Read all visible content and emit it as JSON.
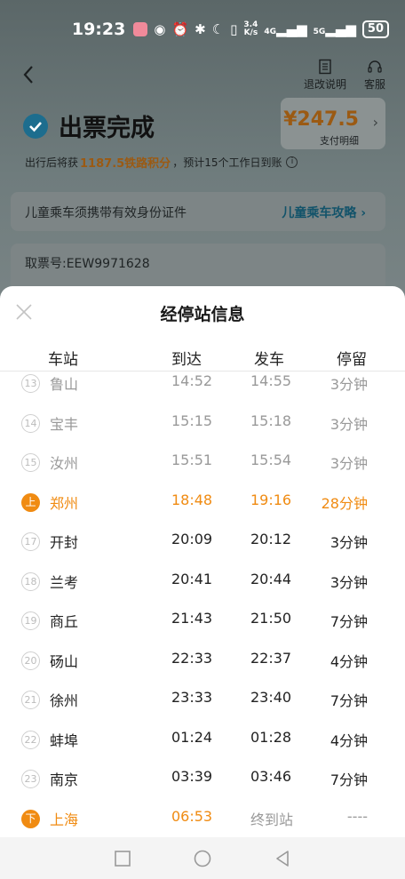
{
  "status_bar": {
    "time": "19:23",
    "speed_top": "3.4",
    "speed_bottom": "K/s",
    "net1": "4G",
    "net2": "5G",
    "battery": "50"
  },
  "header": {
    "refund_label": "退改说明",
    "service_label": "客服"
  },
  "ticket": {
    "title": "出票完成",
    "price": "¥247.5",
    "price_detail": "支付明细",
    "points_prefix": "出行后将获",
    "points_value": "1187.5铁路积分",
    "points_suffix": "，预计15个工作日到账"
  },
  "child_notice": {
    "text": "儿童乘车须携带有效身份证件",
    "link": "儿童乘车攻略 ›"
  },
  "ticket_no": "取票号:EEW9971628",
  "sheet": {
    "title": "经停站信息",
    "columns": {
      "station": "车站",
      "arrive": "到达",
      "depart": "发车",
      "stay": "停留"
    },
    "rows": [
      {
        "idx": "13",
        "station": "鲁山",
        "arrive": "14:52",
        "depart": "14:55",
        "stay": "3分钟",
        "state": "passed"
      },
      {
        "idx": "14",
        "station": "宝丰",
        "arrive": "15:15",
        "depart": "15:18",
        "stay": "3分钟",
        "state": "passed"
      },
      {
        "idx": "15",
        "station": "汝州",
        "arrive": "15:51",
        "depart": "15:54",
        "stay": "3分钟",
        "state": "passed"
      },
      {
        "idx": "上",
        "station": "郑州",
        "arrive": "18:48",
        "depart": "19:16",
        "stay": "28分钟",
        "state": "board"
      },
      {
        "idx": "17",
        "station": "开封",
        "arrive": "20:09",
        "depart": "20:12",
        "stay": "3分钟",
        "state": "normal"
      },
      {
        "idx": "18",
        "station": "兰考",
        "arrive": "20:41",
        "depart": "20:44",
        "stay": "3分钟",
        "state": "normal"
      },
      {
        "idx": "19",
        "station": "商丘",
        "arrive": "21:43",
        "depart": "21:50",
        "stay": "7分钟",
        "state": "normal"
      },
      {
        "idx": "20",
        "station": "砀山",
        "arrive": "22:33",
        "depart": "22:37",
        "stay": "4分钟",
        "state": "normal"
      },
      {
        "idx": "21",
        "station": "徐州",
        "arrive": "23:33",
        "depart": "23:40",
        "stay": "7分钟",
        "state": "normal"
      },
      {
        "idx": "22",
        "station": "蚌埠",
        "arrive": "01:24",
        "depart": "01:28",
        "stay": "4分钟",
        "state": "normal"
      },
      {
        "idx": "23",
        "station": "南京",
        "arrive": "03:39",
        "depart": "03:46",
        "stay": "7分钟",
        "state": "normal"
      },
      {
        "idx": "下",
        "station": "上海",
        "arrive": "06:53",
        "depart": "终到站",
        "stay": "----",
        "state": "alight"
      }
    ]
  },
  "colors": {
    "accent": "#f08b12",
    "passed": "#999999"
  }
}
